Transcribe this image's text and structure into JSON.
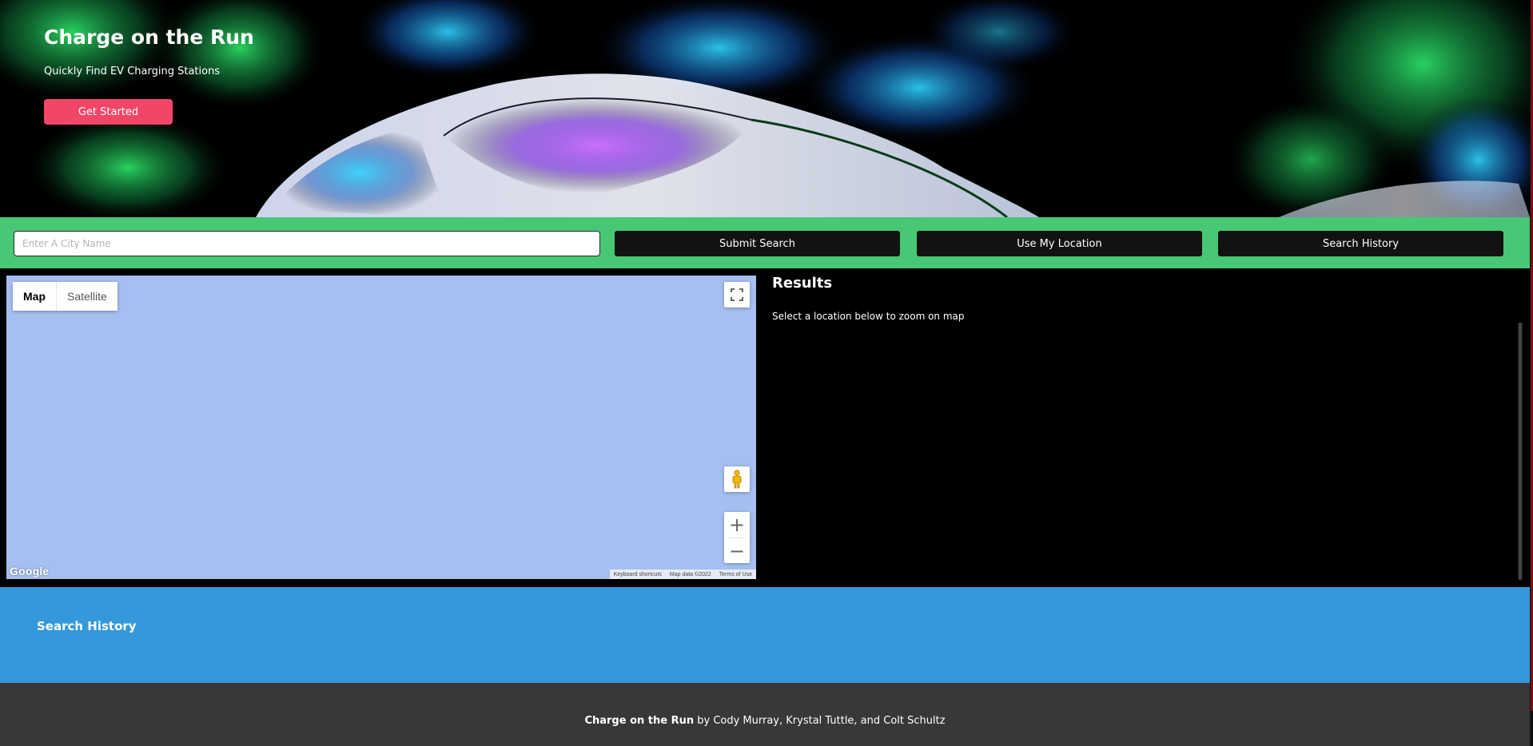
{
  "hero": {
    "title": "Charge on the Run",
    "subtitle": "Quickly Find EV Charging Stations",
    "cta_label": "Get Started"
  },
  "search": {
    "placeholder": "Enter A City Name",
    "value": "",
    "submit_label": "Submit Search",
    "location_label": "Use My Location",
    "history_label": "Search History"
  },
  "map": {
    "type_options": [
      "Map",
      "Satellite"
    ],
    "selected_type": "Map",
    "fullscreen_icon": "fullscreen-icon",
    "pegman_icon": "pegman-icon",
    "zoom_in": "+",
    "zoom_out": "−",
    "logo": "Google",
    "attribution": [
      "Keyboard shortcuts",
      "Map data ©2022",
      "Terms of Use"
    ]
  },
  "results": {
    "title": "Results",
    "instructions": "Select a location below to zoom on map"
  },
  "history_section": {
    "title": "Search History"
  },
  "footer": {
    "brand": "Charge on the Run",
    "credit": " by Cody Murray, Krystal Tuttle, and Colt Schultz"
  },
  "colors": {
    "cta": "#f14668",
    "search_bar": "#48c774",
    "history_bg": "#3498db",
    "footer_bg": "#383838",
    "map_water": "#a5bff0"
  }
}
